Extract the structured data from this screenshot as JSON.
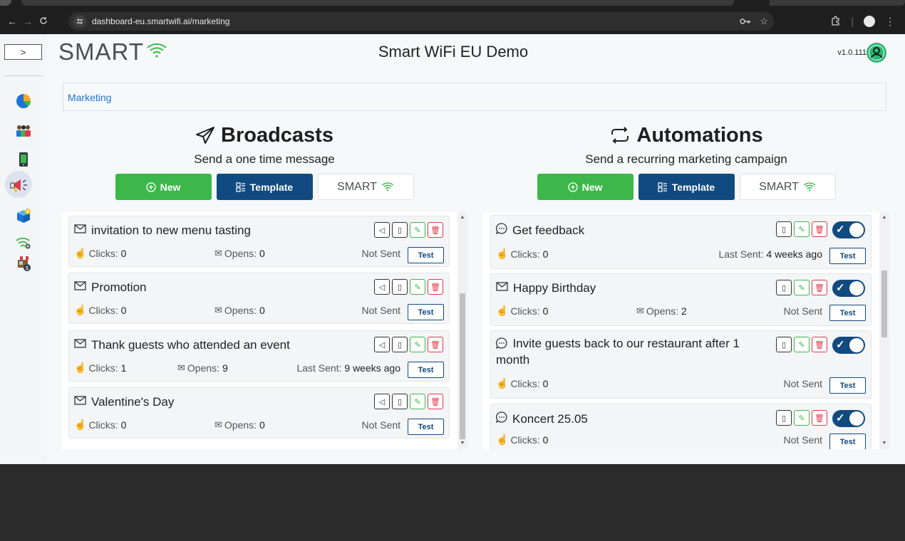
{
  "browser": {
    "url": "dashboard-eu.smartwifi.ai/marketing",
    "nav": {
      "back": "←",
      "forward": "→",
      "reload": "C"
    }
  },
  "header": {
    "logo": "SMART",
    "app_title": "Smart WiFi EU Demo",
    "version": "v1.0.111",
    "sidebar_toggle": ">"
  },
  "breadcrumb": "Marketing",
  "icons": {
    "sidebar": [
      "pie-chart-icon",
      "users-icon",
      "mobile-icon",
      "megaphone-icon",
      "box-icon",
      "wifi-settings-icon",
      "store-icon"
    ]
  },
  "colors": {
    "green": "#3cb84a",
    "navy": "#114a80",
    "red": "#e03a4e",
    "link": "#1d73d6"
  },
  "broadcasts": {
    "title": "Broadcasts",
    "subtitle": "Send a one time message",
    "buttons": {
      "new": "New",
      "template": "Template",
      "smart": "SMART"
    },
    "items": [
      {
        "title": "invitation to new menu tasting",
        "clicks_label": "Clicks:",
        "clicks": "0",
        "opens_label": "Opens:",
        "opens": "0",
        "status": "Not Sent",
        "status_value": "",
        "test": "Test"
      },
      {
        "title": "Promotion",
        "clicks_label": "Clicks:",
        "clicks": "0",
        "opens_label": "Opens:",
        "opens": "0",
        "status": "Not Sent",
        "status_value": "",
        "test": "Test"
      },
      {
        "title": "Thank guests who attended an event",
        "clicks_label": "Clicks:",
        "clicks": "1",
        "opens_label": "Opens:",
        "opens": "9",
        "status": "Last Sent:",
        "status_value": "9 weeks ago",
        "test": "Test"
      },
      {
        "title": "Valentine's Day",
        "clicks_label": "Clicks:",
        "clicks": "0",
        "opens_label": "Opens:",
        "opens": "0",
        "status": "Not Sent",
        "status_value": "",
        "test": "Test"
      }
    ]
  },
  "automations": {
    "title": "Automations",
    "subtitle": "Send a recurring marketing campaign",
    "buttons": {
      "new": "New",
      "template": "Template",
      "smart": "SMART"
    },
    "items": [
      {
        "title": "Get feedback",
        "clicks_label": "Clicks:",
        "clicks": "0",
        "status": "Last Sent:",
        "status_value": "4 weeks ago",
        "test": "Test",
        "enabled": true
      },
      {
        "title": "Happy Birthday",
        "clicks_label": "Clicks:",
        "clicks": "0",
        "opens_label": "Opens:",
        "opens": "2",
        "status": "Not Sent",
        "status_value": "",
        "test": "Test",
        "enabled": true
      },
      {
        "title": "Invite guests back to our restaurant after 1 month",
        "clicks_label": "Clicks:",
        "clicks": "0",
        "status": "Not Sent",
        "status_value": "",
        "test": "Test",
        "enabled": true
      },
      {
        "title": "Koncert 25.05",
        "clicks_label": "Clicks:",
        "clicks": "0",
        "status": "Not Sent",
        "status_value": "",
        "test": "Test",
        "enabled": true
      }
    ]
  }
}
